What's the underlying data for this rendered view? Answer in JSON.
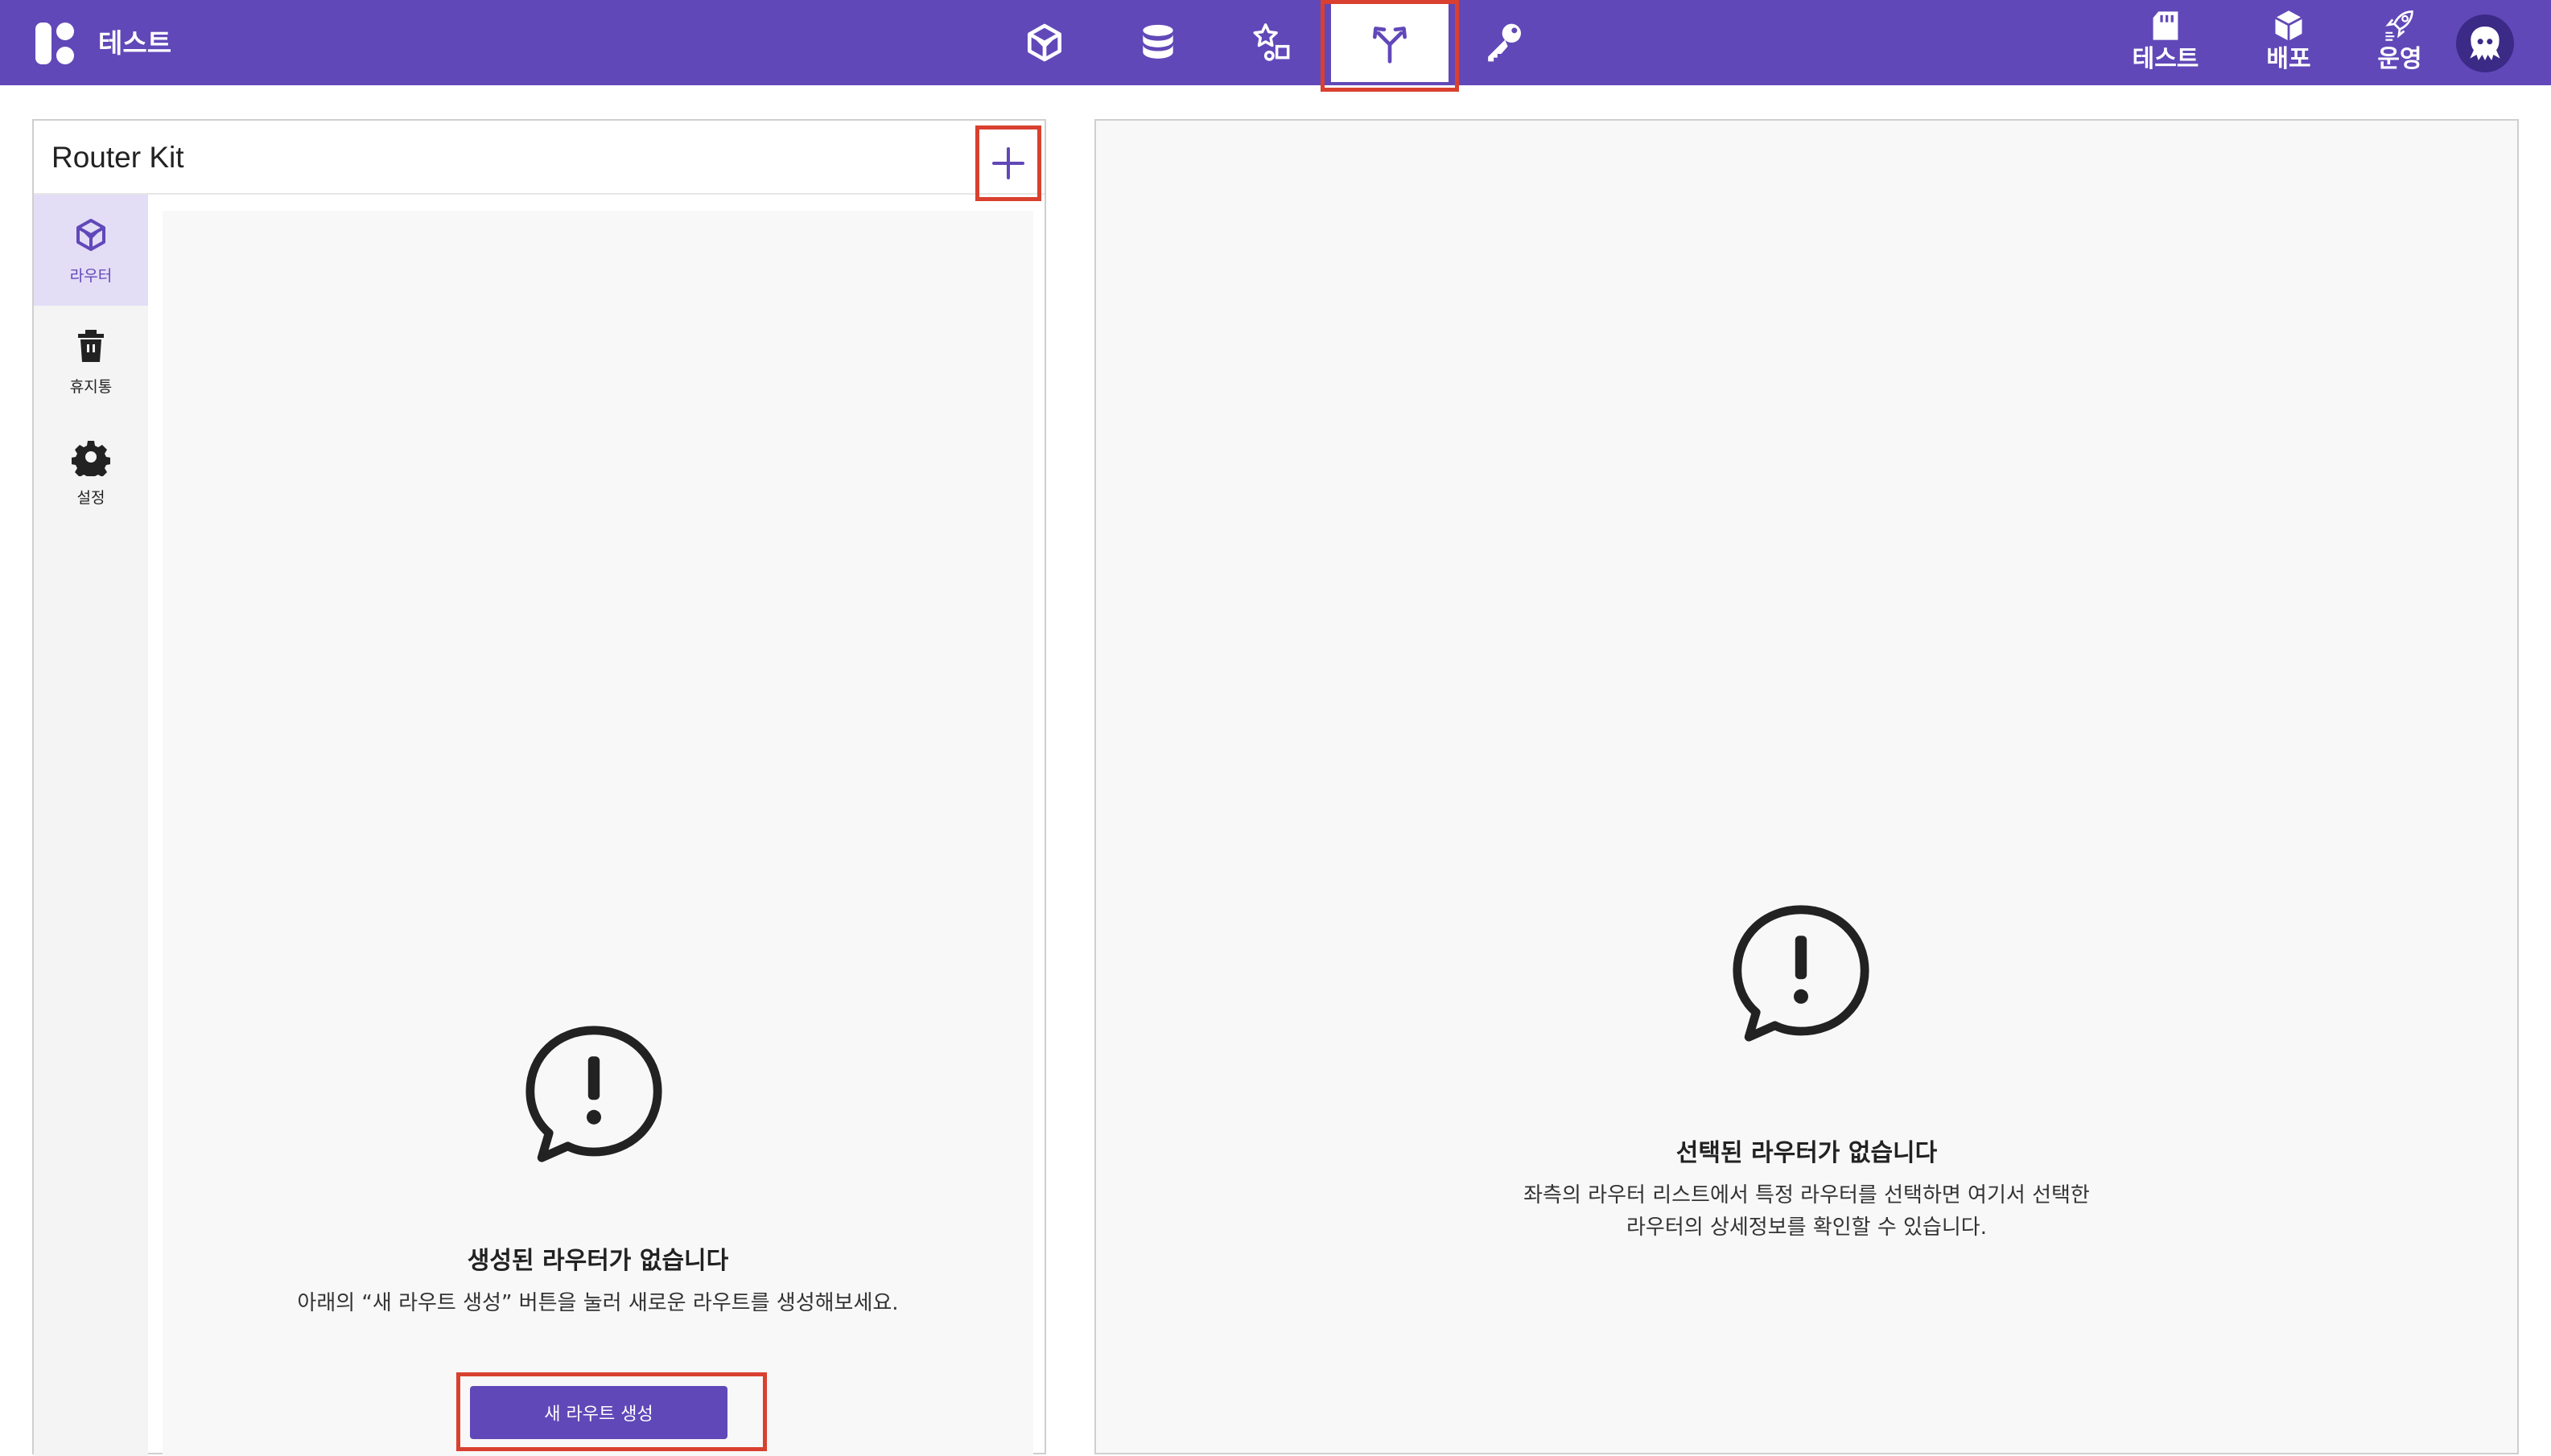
{
  "header": {
    "project_name": "테스트",
    "nav_icons": [
      "cube-icon",
      "database-icon",
      "shapes-icon",
      "router-icon",
      "key-icon"
    ],
    "active_nav": "router-icon",
    "right_items": [
      {
        "label": "테스트",
        "icon": "sd-card-icon"
      },
      {
        "label": "배포",
        "icon": "box-icon"
      },
      {
        "label": "운영",
        "icon": "rocket-icon"
      }
    ],
    "avatar_icon": "octopus-avatar-icon",
    "colors": {
      "bar": "#6148b8",
      "highlight": "#d9402f"
    }
  },
  "left_panel": {
    "title": "Router Kit",
    "add_icon": "plus-icon",
    "side_nav": [
      {
        "label": "라우터",
        "icon": "cube-icon",
        "active": true
      },
      {
        "label": "휴지통",
        "icon": "trash-icon",
        "active": false
      },
      {
        "label": "설정",
        "icon": "gear-icon",
        "active": false
      }
    ],
    "empty": {
      "icon": "alert-bubble-icon",
      "title": "생성된 라우터가 없습니다",
      "description": "아래의 “새 라우트 생성” 버튼을 눌러 새로운 라우트를 생성해보세요.",
      "button_label": "새 라우트 생성"
    }
  },
  "right_panel": {
    "empty": {
      "icon": "alert-bubble-icon",
      "title": "선택된 라우터가 없습니다",
      "description_line1": "좌측의 라우터 리스트에서 특정 라우터를 선택하면 여기서 선택한",
      "description_line2": "라우터의 상세정보를 확인할 수 있습니다."
    }
  }
}
